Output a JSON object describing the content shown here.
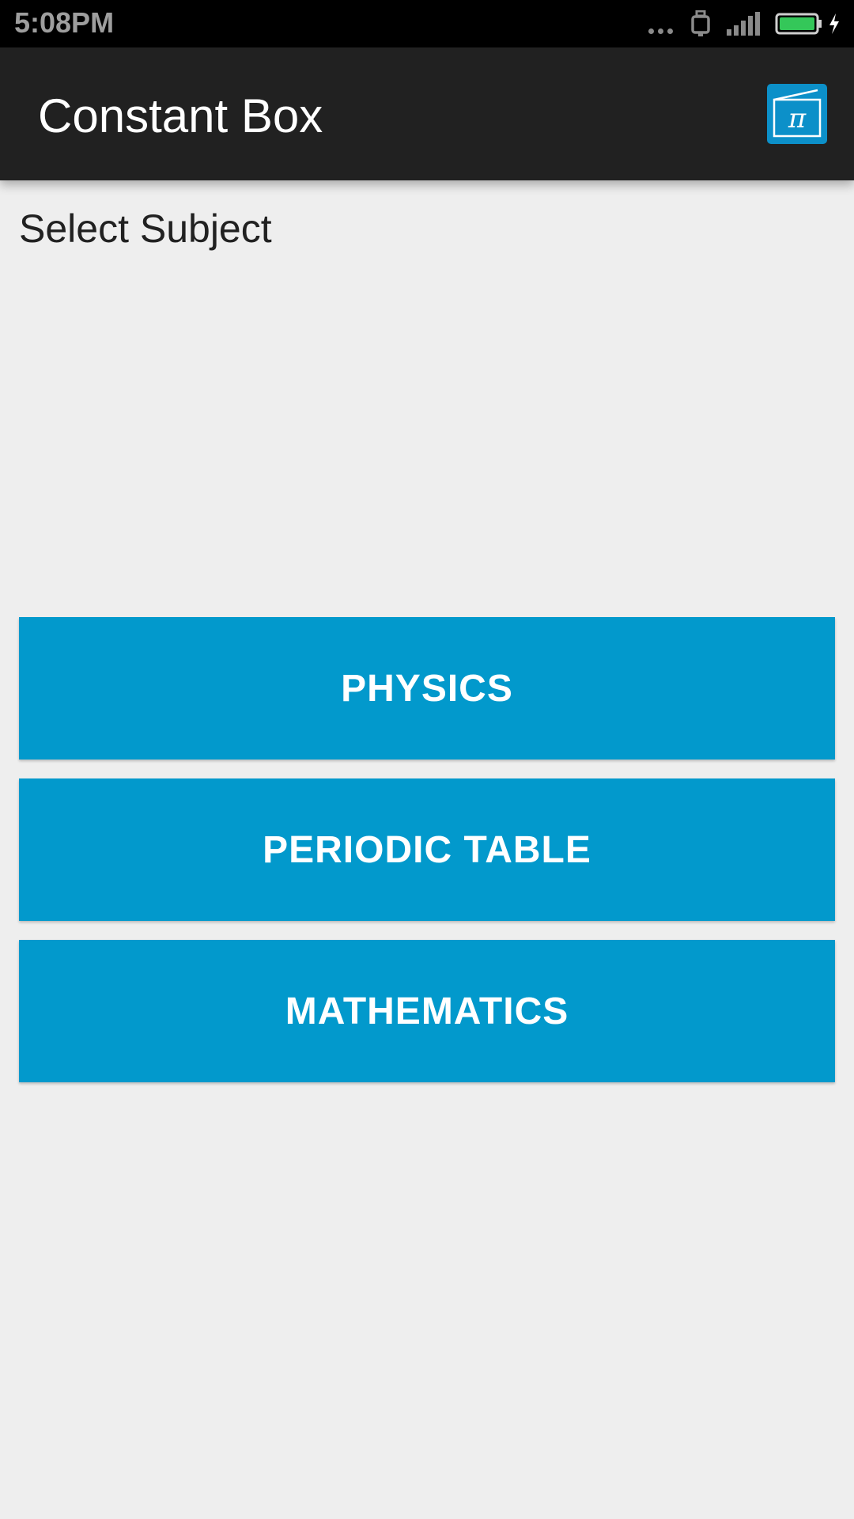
{
  "status_bar": {
    "time": "5:08PM",
    "icons": [
      "more-dots-icon",
      "alarm-icon",
      "signal-icon",
      "battery-charging-icon",
      "charge-bolt-icon"
    ],
    "battery_color": "#34c759"
  },
  "app_bar": {
    "title": "Constant Box",
    "logo_icon": "pi-board-icon",
    "logo_glyph": "π",
    "background": "#212121",
    "logo_color": "#0c90c9"
  },
  "main": {
    "label": "Select Subject",
    "buttons": [
      {
        "label": "PHYSICS"
      },
      {
        "label": "PERIODIC TABLE"
      },
      {
        "label": "MATHEMATICS"
      }
    ],
    "button_color": "#0299cc",
    "background": "#eeeeee"
  }
}
